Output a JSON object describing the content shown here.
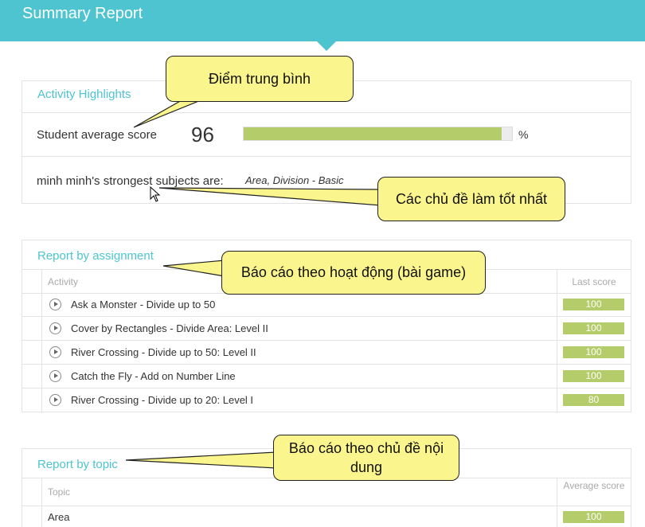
{
  "header": {
    "title": "Summary Report"
  },
  "highlights": {
    "title": "Activity Highlights",
    "avg_label": "Student average score",
    "avg_value": "96",
    "avg_fraction": 0.96,
    "avg_unit": "%",
    "strong_label": "minh minh's strongest subjects are:",
    "strong_value": "Area, Division - Basic"
  },
  "assignments": {
    "title": "Report by assignment",
    "col_activity": "Activity",
    "col_score": "Last score",
    "rows": [
      {
        "name": "Ask a Monster - Divide up to 50",
        "score": "100"
      },
      {
        "name": "Cover by Rectangles - Divide Area: Level II",
        "score": "100"
      },
      {
        "name": "River Crossing - Divide up to 50: Level II",
        "score": "100"
      },
      {
        "name": "Catch the Fly - Add on Number Line",
        "score": "100"
      },
      {
        "name": "River Crossing - Divide up to 20: Level I",
        "score": "80"
      }
    ]
  },
  "topics": {
    "title": "Report by topic",
    "col_topic": "Topic",
    "col_score": "Average score",
    "rows": [
      {
        "name": "Area",
        "score": "100"
      }
    ]
  },
  "callouts": {
    "avg": "Điểm trung bình",
    "strong": "Các chủ đề làm tốt nhất",
    "assign": "Báo cáo theo hoạt động (bài game)",
    "topic": "Báo cáo theo chủ đề nội dung"
  },
  "colors": {
    "accent": "#4dc4cf",
    "score_bar": "#b5cc6a",
    "callout": "#fbf58d"
  }
}
